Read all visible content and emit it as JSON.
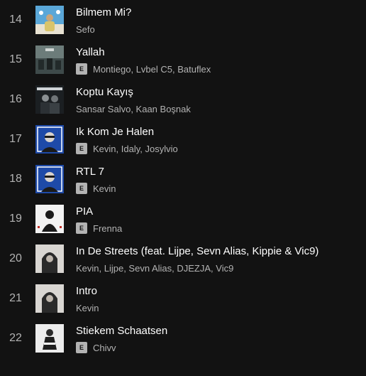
{
  "tracks": [
    {
      "index": "14",
      "title": "Bilmem Mi?",
      "explicit": false,
      "artists": "Sefo",
      "cover_icon": "album-cover-sky-figure"
    },
    {
      "index": "15",
      "title": "Yallah",
      "explicit": true,
      "artists": "Montiego, Lvbel C5, Batuflex",
      "cover_icon": "album-cover-street"
    },
    {
      "index": "16",
      "title": "Koptu Kayış",
      "explicit": false,
      "artists": "Sansar Salvo, Kaan Boşnak",
      "cover_icon": "album-cover-duo"
    },
    {
      "index": "17",
      "title": "Ik Kom Je Halen",
      "explicit": true,
      "artists": "Kevin, Idaly, Josylvio",
      "cover_icon": "album-cover-blue-portrait"
    },
    {
      "index": "18",
      "title": "RTL 7",
      "explicit": true,
      "artists": "Kevin",
      "cover_icon": "album-cover-blue-portrait"
    },
    {
      "index": "19",
      "title": "PIA",
      "explicit": true,
      "artists": "Frenna",
      "cover_icon": "album-cover-white-figure"
    },
    {
      "index": "20",
      "title": "In De Streets (feat. Lijpe, Sevn Alias, Kippie & Vic9)",
      "explicit": false,
      "artists": "Kevin, Lijpe, Sevn Alias, DJEZJA, Vic9",
      "cover_icon": "album-cover-hood-portrait"
    },
    {
      "index": "21",
      "title": "Intro",
      "explicit": false,
      "artists": "Kevin",
      "cover_icon": "album-cover-hood-portrait"
    },
    {
      "index": "22",
      "title": "Stiekem Schaatsen",
      "explicit": true,
      "artists": "Chivv",
      "cover_icon": "album-cover-white-figure-dark"
    }
  ],
  "explicit_badge": "E",
  "colors": {
    "background": "#121212",
    "title": "#ffffff",
    "secondary": "#b3b3b3"
  }
}
